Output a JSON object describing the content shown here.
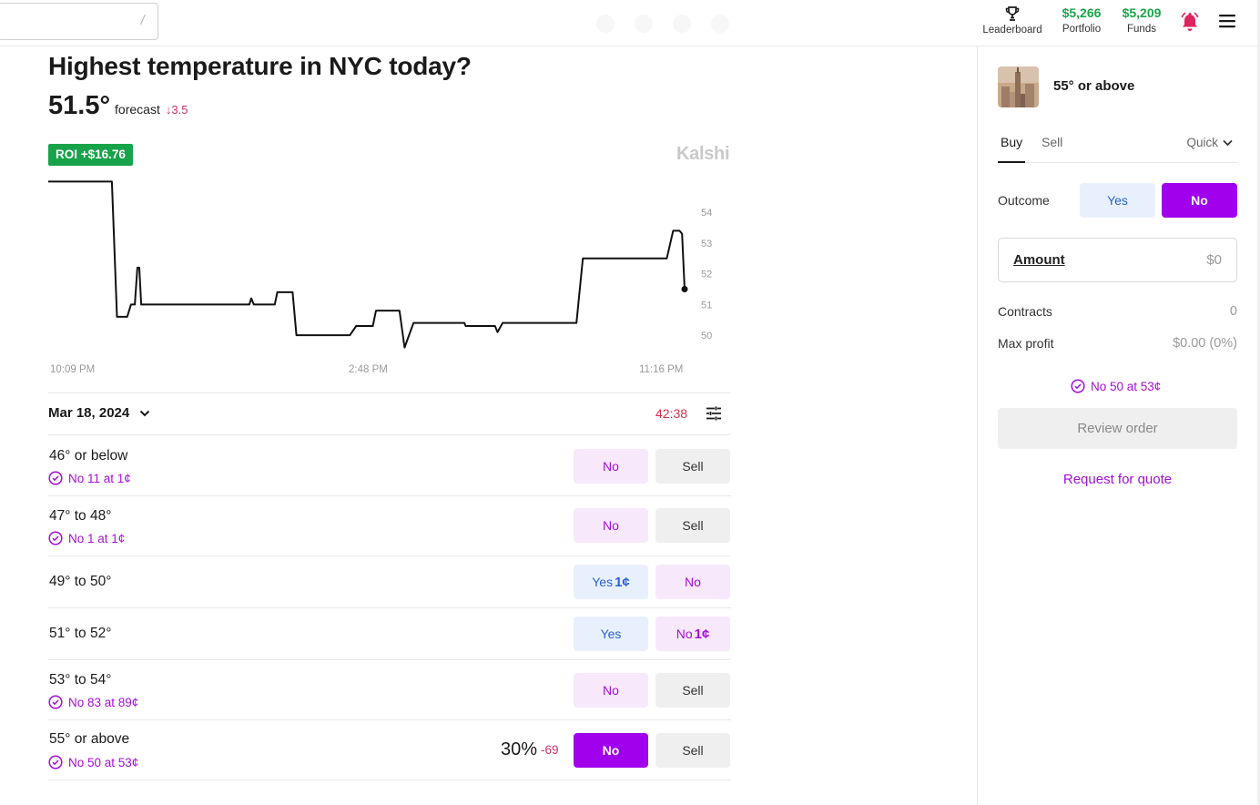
{
  "header": {
    "search": {
      "value": "",
      "placeholder": "",
      "shortcut": "/"
    },
    "leaderboard_label": "Leaderboard",
    "portfolio": {
      "value": "$5,266",
      "label": "Portfolio"
    },
    "funds": {
      "value": "$5,209",
      "label": "Funds"
    },
    "icons": [
      "trophy-icon",
      "bell-icon",
      "menu-icon"
    ]
  },
  "market": {
    "title": "Highest temperature in NYC today?",
    "forecast_value": "51.5°",
    "forecast_label": "forecast",
    "forecast_change": "↓3.5",
    "roi_badge": "ROI +$16.76",
    "brand": "Kalshi"
  },
  "chart_data": {
    "type": "line",
    "title": "",
    "xlabel": "",
    "ylabel": "",
    "x_tick_labels": [
      "10:09 PM",
      "2:48 PM",
      "11:16 PM"
    ],
    "y_ticks": [
      54,
      53,
      52,
      51,
      50
    ],
    "ylim": [
      49.5,
      55.1
    ],
    "xlim": [
      0,
      100
    ],
    "y_axis_side": "right",
    "grid": false,
    "series": [
      {
        "values": [
          [
            0,
            55.0
          ],
          [
            10.0,
            55.0
          ],
          [
            10.8,
            50.6
          ],
          [
            12.4,
            50.6
          ],
          [
            13.0,
            51.0
          ],
          [
            13.6,
            51.0
          ],
          [
            14.0,
            52.2
          ],
          [
            14.3,
            52.2
          ],
          [
            14.6,
            51.0
          ],
          [
            31.6,
            51.0
          ],
          [
            31.9,
            51.2
          ],
          [
            32.3,
            51.0
          ],
          [
            35.6,
            51.0
          ],
          [
            36.0,
            51.4
          ],
          [
            38.4,
            51.4
          ],
          [
            39.0,
            50.0
          ],
          [
            47.4,
            50.0
          ],
          [
            48.4,
            50.3
          ],
          [
            51.0,
            50.3
          ],
          [
            51.5,
            50.8
          ],
          [
            55.2,
            50.8
          ],
          [
            56.0,
            49.6
          ],
          [
            57.4,
            50.4
          ],
          [
            65.4,
            50.4
          ],
          [
            65.6,
            50.3
          ],
          [
            70.2,
            50.3
          ],
          [
            70.6,
            50.1
          ],
          [
            71.4,
            50.4
          ],
          [
            83.0,
            50.4
          ],
          [
            84.0,
            52.5
          ],
          [
            97.2,
            52.5
          ],
          [
            98.2,
            53.4
          ],
          [
            99.2,
            53.4
          ],
          [
            99.6,
            53.3
          ],
          [
            100,
            51.5
          ]
        ]
      }
    ],
    "current_point": [
      100,
      51.5
    ]
  },
  "date_row": {
    "date": "Mar 18, 2024",
    "timer": "42:38"
  },
  "markets": [
    {
      "name": "46° or below",
      "position": "No 11 at 1¢",
      "buttons": [
        {
          "label": "No",
          "style": "no"
        },
        {
          "label": "Sell",
          "style": "sell"
        }
      ]
    },
    {
      "name": "47° to 48°",
      "position": "No 1 at 1¢",
      "buttons": [
        {
          "label": "No",
          "style": "no"
        },
        {
          "label": "Sell",
          "style": "sell"
        }
      ]
    },
    {
      "name": "49° to 50°",
      "position": "",
      "buttons": [
        {
          "label": "Yes",
          "price": "1¢",
          "style": "yes"
        },
        {
          "label": "No",
          "style": "no"
        }
      ]
    },
    {
      "name": "51° to 52°",
      "position": "",
      "buttons": [
        {
          "label": "Yes",
          "style": "yes"
        },
        {
          "label": "No",
          "price": "1¢",
          "style": "no"
        }
      ]
    },
    {
      "name": "53° to 54°",
      "position": "No 83 at 89¢",
      "buttons": [
        {
          "label": "No",
          "style": "no"
        },
        {
          "label": "Sell",
          "style": "sell"
        }
      ]
    },
    {
      "name": "55° or above",
      "position": "No 50 at 53¢",
      "chance": "30%",
      "chance_change": "-69",
      "buttons": [
        {
          "label": "No",
          "style": "no-solid"
        },
        {
          "label": "Sell",
          "style": "sell"
        }
      ]
    }
  ],
  "order_panel": {
    "title": "55° or above",
    "tabs": [
      "Buy",
      "Sell"
    ],
    "mode": "Quick",
    "outcome_label": "Outcome",
    "outcome_yes": "Yes",
    "outcome_no": "No",
    "amount_label": "Amount",
    "amount_value": "$0",
    "contracts_label": "Contracts",
    "contracts_value": "0",
    "max_profit_label": "Max profit",
    "max_profit_value": "$0.00 (0%)",
    "position_note": "No 50 at 53¢",
    "review_label": "Review order",
    "rfq_label": "Request for quote"
  },
  "colors": {
    "positive": "#1aa64a",
    "negative": "#d32f6b",
    "accent_purple": "#a000ec",
    "yes_blue": "#2962d8"
  }
}
